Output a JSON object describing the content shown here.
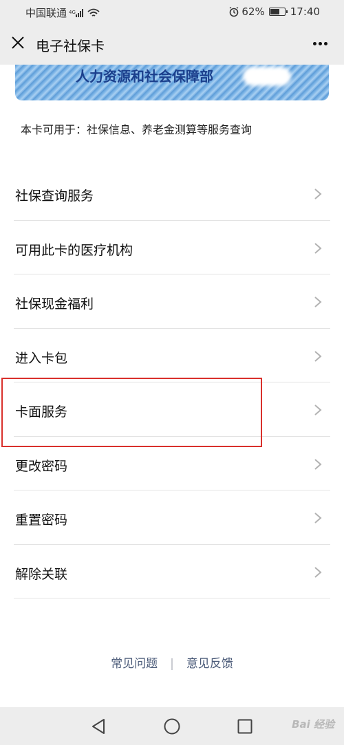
{
  "status_bar": {
    "carrier": "中国联通",
    "network": "4G",
    "battery_percent": "62%",
    "time": "17:40",
    "battery_level": 0.62
  },
  "nav": {
    "title": "电子社保卡"
  },
  "card": {
    "ministry": "人力资源和社会保障部"
  },
  "usage_text": "本卡可用于：社保信息、养老金测算等服务查询",
  "menu": [
    {
      "label": "社保查询服务"
    },
    {
      "label": "可用此卡的医疗机构"
    },
    {
      "label": "社保现金福利"
    },
    {
      "label": "进入卡包"
    },
    {
      "label": "卡面服务"
    },
    {
      "label": "更改密码"
    },
    {
      "label": "重置密码"
    },
    {
      "label": "解除关联"
    }
  ],
  "footer": {
    "faq": "常见问题",
    "separator": "|",
    "feedback": "意见反馈"
  },
  "watermark": "Bai 经验",
  "colors": {
    "highlight": "#d9302c",
    "link": "#4a5a78",
    "bar_background": "#ededed"
  }
}
